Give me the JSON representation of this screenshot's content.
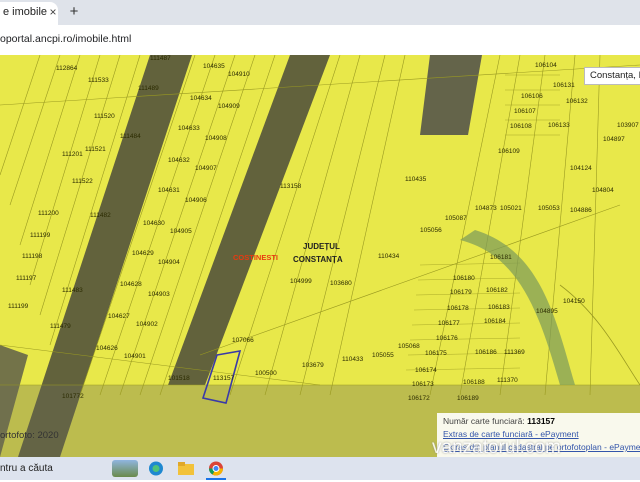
{
  "browser": {
    "tab_title": "e imobile",
    "tab_close": "×",
    "new_tab": "+",
    "url": "oportal.ancpi.ro/imobile.html"
  },
  "map": {
    "search_value": "Constanța, R",
    "place_costinesti": "COSTINESTI",
    "place_judet_line1": "JUDEȚUL",
    "place_judet_line2": "CONSTANȚA",
    "orthophoto_label": "ortofoto: 2020",
    "colors": {
      "parcel_fill": "#e8e84a",
      "parcel_border": "#9a9a20",
      "highlight": "#3a3aa8",
      "costinesti": "#e83a10"
    },
    "parcels": [
      "112864",
      "104635",
      "111487",
      "104910",
      "111533",
      "104634",
      "111489",
      "104909",
      "111520",
      "104633",
      "111484",
      "104908",
      "111201",
      "111521",
      "104632",
      "104907",
      "111522",
      "104631",
      "104906",
      "111200",
      "111482",
      "104630",
      "104905",
      "111199",
      "104629",
      "111198",
      "104904",
      "111197",
      "104628",
      "104903",
      "111483",
      "111199",
      "104627",
      "104902",
      "111479",
      "104626",
      "104901",
      "101772",
      "101518",
      "113157",
      "113158",
      "107066",
      "104999",
      "103680",
      "100500",
      "103679",
      "110433",
      "110435",
      "110434",
      "105056",
      "105087",
      "105055",
      "105068",
      "106104",
      "106131",
      "106106",
      "106132",
      "106107",
      "106108",
      "106133",
      "106109",
      "104124",
      "104804",
      "104873",
      "105021",
      "105053",
      "104886",
      "104150",
      "104895",
      "106180",
      "106181",
      "106179",
      "106182",
      "106178",
      "106183",
      "106177",
      "106184",
      "106176",
      "106186",
      "106175",
      "106174",
      "106173",
      "106188",
      "106172",
      "106189",
      "111369",
      "111370",
      "103907",
      "104897"
    ]
  },
  "info_panel": {
    "carte_label": "Număr carte funciară:",
    "carte_number": "113157",
    "link1": "Extras de carte funciară - ePayment",
    "link2": "Extras din planul cadastral pe ortofotoplan - ePayme"
  },
  "taskbar": {
    "search_text": "ntru a căuta",
    "icons": [
      "landscape-widget-icon",
      "edge-icon",
      "file-explorer-icon",
      "chrome-icon"
    ]
  },
  "watermark": "vanzatorul.com"
}
